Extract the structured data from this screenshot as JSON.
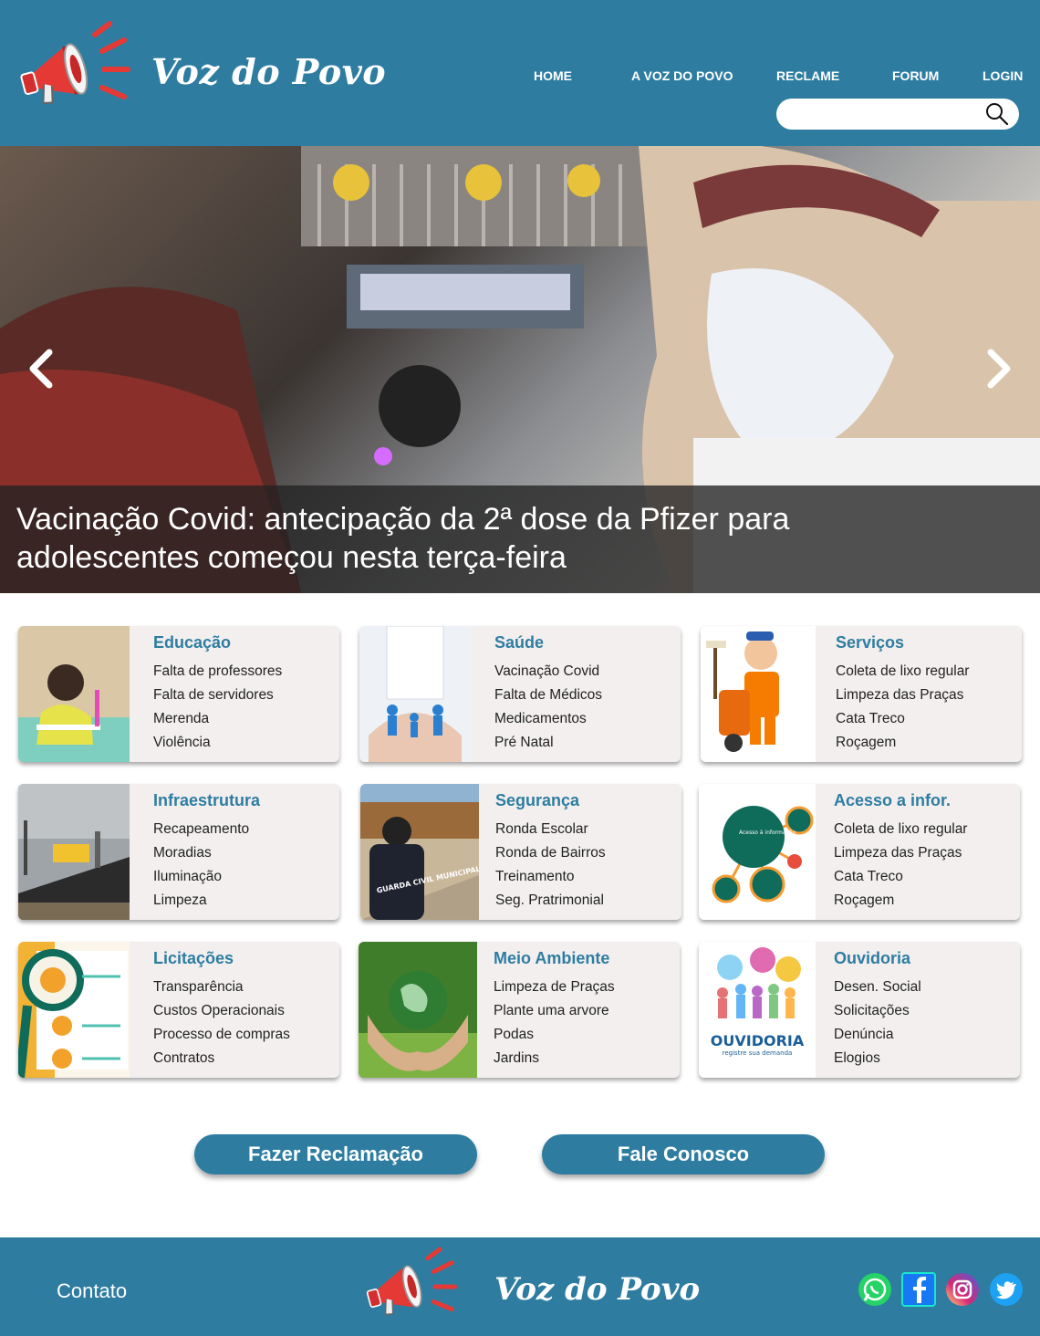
{
  "header": {
    "brand": "Voz do Povo",
    "nav": [
      "HOME",
      "A VOZ DO POVO",
      "RECLAME",
      "FORUM",
      "LOGIN"
    ],
    "search_placeholder": ""
  },
  "hero": {
    "title": "Vacinação Covid: antecipação da 2ª dose da Pfizer para adolescentes começou nesta terça-feira"
  },
  "categories": [
    {
      "title": "Educação",
      "items": [
        "Falta de professores",
        "Falta de servidores",
        "Merenda",
        "Violência"
      ]
    },
    {
      "title": "Saúde",
      "items": [
        "Vacinação Covid",
        "Falta de Médicos",
        "Medicamentos",
        "Pré Natal"
      ]
    },
    {
      "title": "Serviços",
      "items": [
        "Coleta de lixo regular",
        "Limpeza das Praças",
        "Cata Treco",
        "Roçagem"
      ]
    },
    {
      "title": "Infraestrutura",
      "items": [
        "Recapeamento",
        "Moradias",
        "Iluminação",
        "Limpeza"
      ]
    },
    {
      "title": "Segurança",
      "items": [
        "Ronda Escolar",
        "Ronda de Bairros",
        "Treinamento",
        "Seg. Pratrimonial"
      ]
    },
    {
      "title": "Acesso a infor.",
      "items": [
        "Coleta de lixo regular",
        "Limpeza das Praças",
        "Cata Treco",
        "Roçagem"
      ]
    },
    {
      "title": "Licitações",
      "items": [
        "Transparência",
        "Custos Operacionais",
        "Processo de compras",
        "Contratos"
      ]
    },
    {
      "title": "Meio Ambiente",
      "items": [
        "Limpeza de Praças",
        "Plante uma arvore",
        "Podas",
        "Jardins"
      ]
    },
    {
      "title": "Ouvidoria",
      "items": [
        "Desen. Social",
        "Solicitações",
        "Denúncia",
        "Elogios"
      ]
    }
  ],
  "image_text": {
    "guarda": "GUARDA CIVIL MUNICIPAL",
    "acesso": "Acesso à informação",
    "ouvidoria": "OUVIDORIA",
    "ouvidoria_sub": "registre sua demanda"
  },
  "buttons": {
    "reclamacao": "Fazer Reclamação",
    "contato": "Fale Conosco"
  },
  "footer": {
    "contato": "Contato",
    "brand": "Voz do Povo",
    "social": [
      "whatsapp-icon",
      "facebook-icon",
      "instagram-icon",
      "twitter-icon"
    ]
  },
  "colors": {
    "primary": "#2e7da1",
    "card_bg": "#f3efef",
    "megaphone_red": "#e53935"
  }
}
